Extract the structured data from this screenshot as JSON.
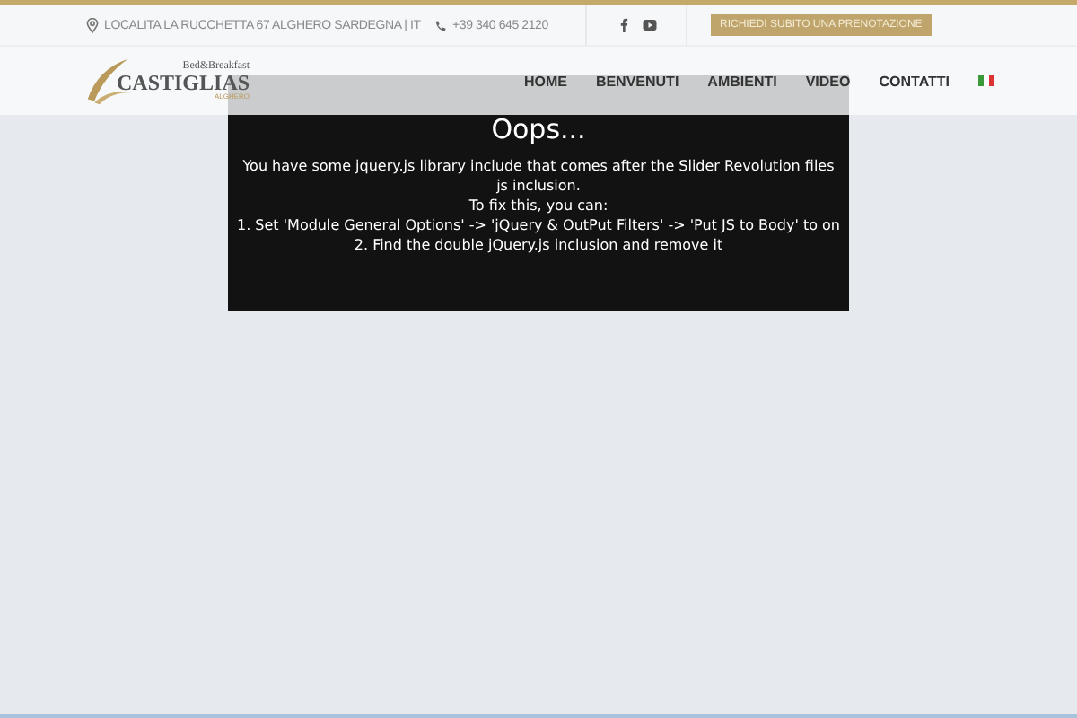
{
  "topbar": {
    "address": "LOCALITA LA RUCCHETTA 67 ALGHERO SARDEGNA | IT",
    "phone": "+39 340 645 2120",
    "booking_button": "RICHIEDI SUBITO UNA PRENOTAZIONE"
  },
  "logo": {
    "tagline": "Bed&Breakfast",
    "name": "CASTIGLIAS",
    "place": "ALGHERO"
  },
  "nav": [
    {
      "label": "HOME"
    },
    {
      "label": "BENVENUTI"
    },
    {
      "label": "AMBIENTI"
    },
    {
      "label": "VIDEO"
    },
    {
      "label": "CONTATTI"
    }
  ],
  "error": {
    "title": "Oops...",
    "lines": [
      "You have some jquery.js library include that comes after the Slider Revolution files js inclusion.",
      "To fix this, you can:",
      "1. Set 'Module General Options' -> 'jQuery & OutPut Filters' -> 'Put JS to Body' to on",
      "2. Find the double jQuery.js inclusion and remove it"
    ]
  }
}
